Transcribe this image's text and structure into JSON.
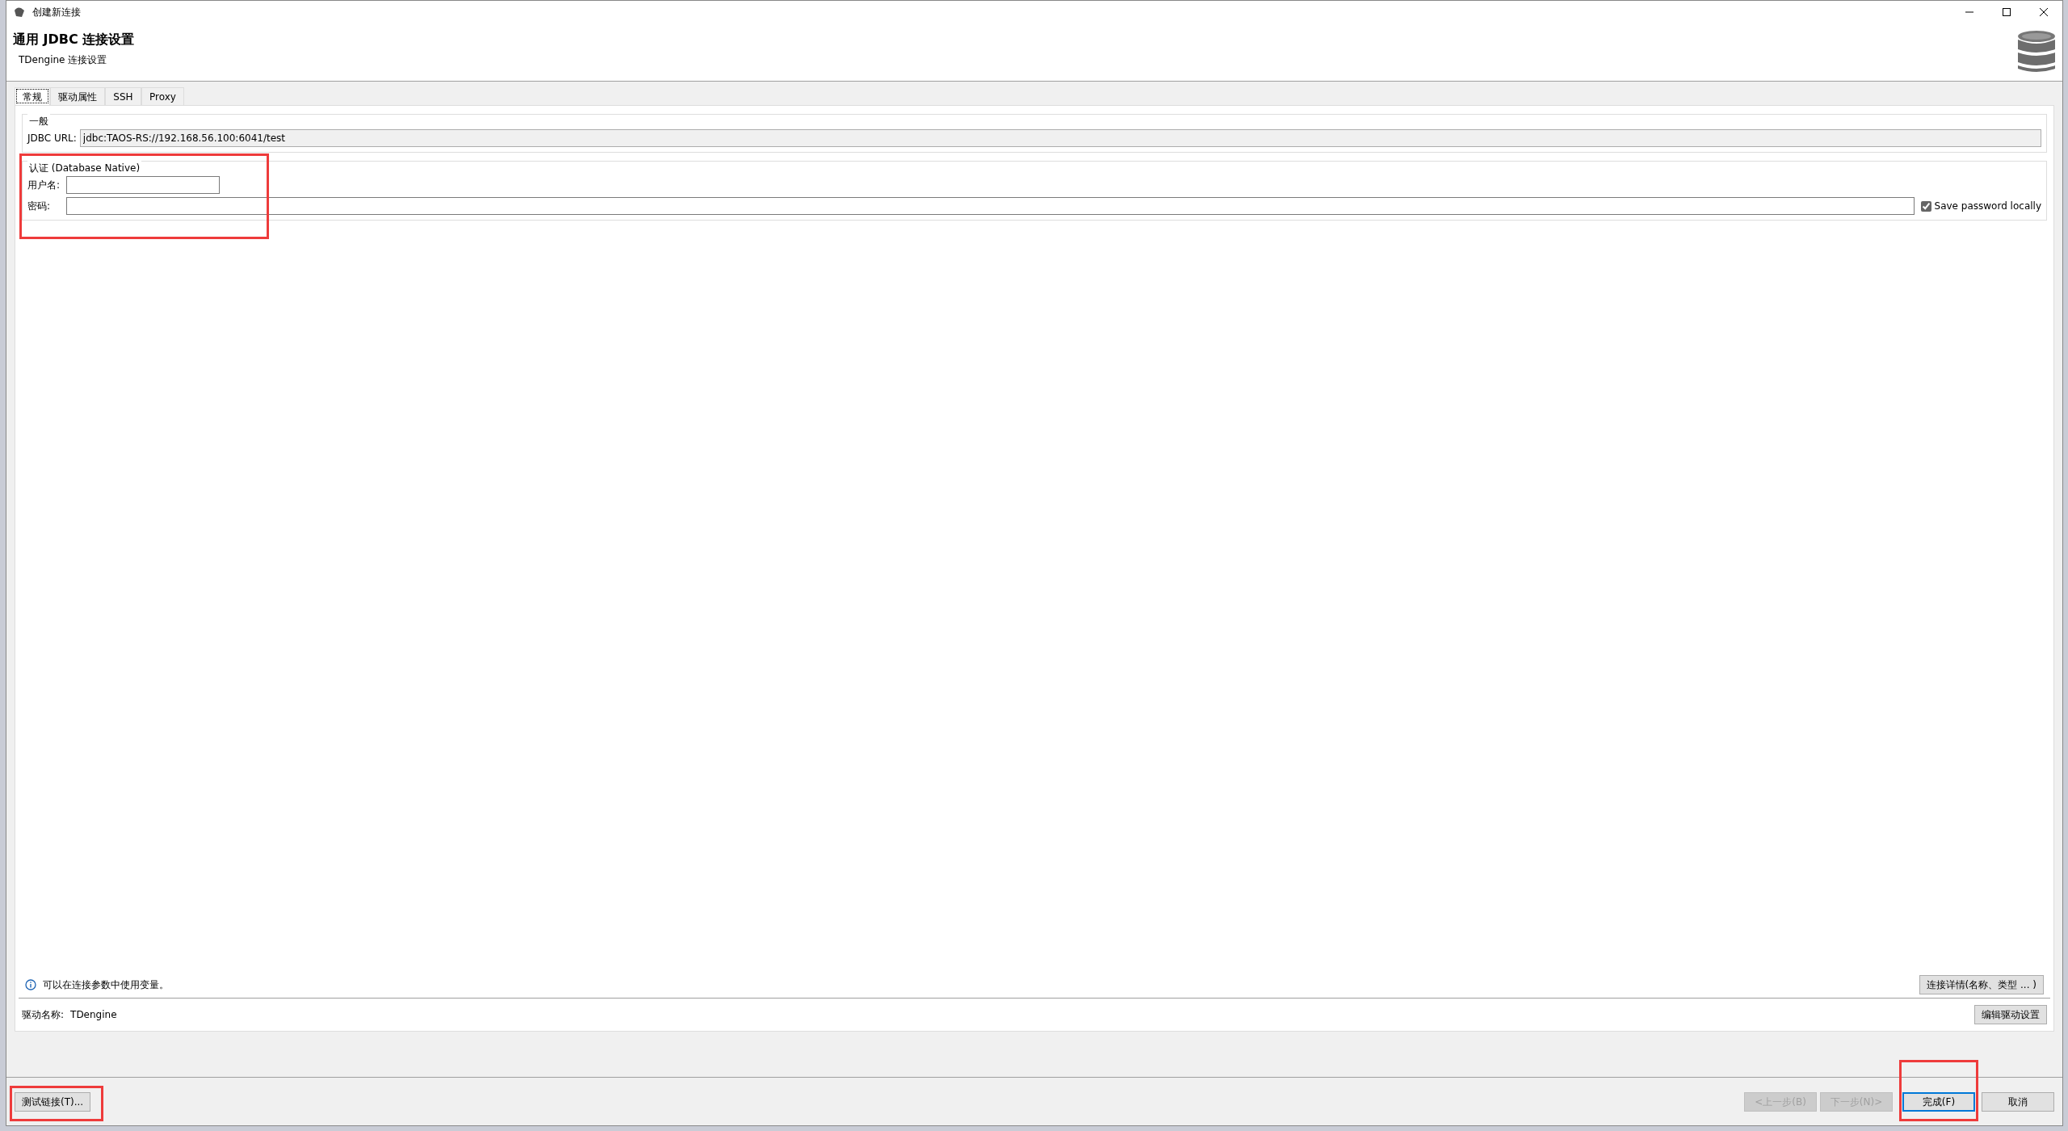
{
  "window": {
    "title": "创建新连接"
  },
  "header": {
    "title": "通用 JDBC 连接设置",
    "subtitle": "TDengine 连接设置"
  },
  "tabs": [
    {
      "label": "常规",
      "selected": true
    },
    {
      "label": "驱动属性",
      "selected": false
    },
    {
      "label": "SSH",
      "selected": false
    },
    {
      "label": "Proxy",
      "selected": false
    }
  ],
  "general_group": {
    "title": "一般",
    "url_label": "JDBC URL:",
    "url_value": "jdbc:TAOS-RS://192.168.56.100:6041/test"
  },
  "auth_group": {
    "title": "认证 (Database Native)",
    "highlighted": true,
    "username_label": "用户名:",
    "password_label": "密码:",
    "save_password": {
      "label": "Save password locally",
      "checked": true
    }
  },
  "info": {
    "text": "可以在连接参数中使用变量。",
    "button": "连接详情(名称、类型 ... )"
  },
  "driver": {
    "label": "驱动名称:",
    "name": "TDengine",
    "button": "编辑驱动设置"
  },
  "footer": {
    "test_button": {
      "label": "测试链接(T)...",
      "highlighted": true
    },
    "buttons": [
      {
        "label": "<上一步(B)",
        "disabled": true,
        "default": false,
        "highlighted": false
      },
      {
        "label": "下一步(N)>",
        "disabled": true,
        "default": false,
        "highlighted": false
      },
      {
        "label": "完成(F)",
        "disabled": false,
        "default": true,
        "highlighted": true
      },
      {
        "label": "取消",
        "disabled": false,
        "default": false,
        "highlighted": false
      }
    ]
  }
}
